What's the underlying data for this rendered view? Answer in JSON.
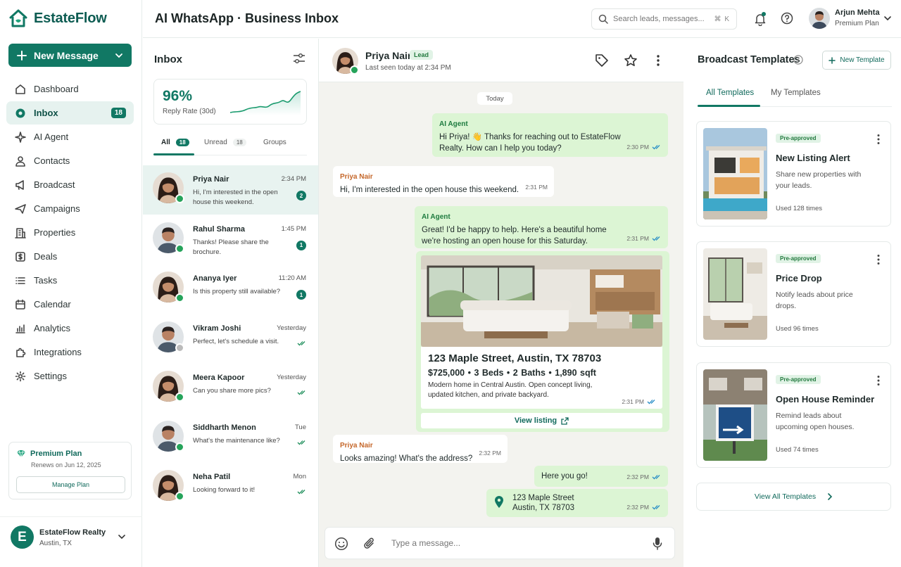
{
  "brand": {
    "name": "EstateFlow",
    "accent": "#117864"
  },
  "sidebar": {
    "new_message": "New Message",
    "items": [
      {
        "label": "Dashboard",
        "icon": "home-icon"
      },
      {
        "label": "Inbox",
        "icon": "inbox-icon",
        "badge": "18",
        "active": true
      },
      {
        "label": "AI Agent",
        "icon": "sparkle-icon"
      },
      {
        "label": "Contacts",
        "icon": "user-icon"
      },
      {
        "label": "Broadcast",
        "icon": "megaphone-icon"
      },
      {
        "label": "Campaigns",
        "icon": "send-icon"
      },
      {
        "label": "Properties",
        "icon": "building-icon"
      },
      {
        "label": "Deals",
        "icon": "dollar-icon"
      },
      {
        "label": "Tasks",
        "icon": "list-icon"
      },
      {
        "label": "Calendar",
        "icon": "calendar-icon"
      },
      {
        "label": "Analytics",
        "icon": "bar-chart-icon"
      },
      {
        "label": "Integrations",
        "icon": "puzzle-icon"
      },
      {
        "label": "Settings",
        "icon": "gear-icon"
      }
    ],
    "plan": {
      "title": "Premium Plan",
      "renews": "Renews on Jun 12, 2025",
      "button": "Manage Plan"
    },
    "account": {
      "initial": "E",
      "name": "EstateFlow Realty",
      "location": "Austin, TX"
    }
  },
  "header": {
    "title": "AI WhatsApp · Business Inbox",
    "search_placeholder": "Search leads, messages...",
    "shortcut": "⌘ K",
    "user": {
      "name": "Arjun Mehta",
      "plan": "Premium Plan"
    }
  },
  "inbox": {
    "title": "Inbox",
    "reply_rate": {
      "value": "96%",
      "label": "Reply Rate (30d)"
    },
    "tabs": [
      {
        "label": "All",
        "count": "18"
      },
      {
        "label": "Unread",
        "count": "18"
      },
      {
        "label": "Groups",
        "count": ""
      }
    ],
    "conversations": [
      {
        "name": "Priya Nair",
        "time": "2:34 PM",
        "preview": "Hi, I'm interested in the open house this weekend.",
        "unread": "2",
        "avatar": "female",
        "selected": true,
        "online": true
      },
      {
        "name": "Rahul Sharma",
        "time": "1:45 PM",
        "preview": "Thanks! Please share the brochure.",
        "unread": "1",
        "avatar": "male",
        "online": true
      },
      {
        "name": "Ananya Iyer",
        "time": "11:20 AM",
        "preview": "Is this property still available?",
        "unread": "1",
        "avatar": "female",
        "online": true
      },
      {
        "name": "Vikram Joshi",
        "time": "Yesterday",
        "preview": "Perfect, let's schedule a visit.",
        "unread": "",
        "avatar": "male",
        "online": false
      },
      {
        "name": "Meera Kapoor",
        "time": "Yesterday",
        "preview": "Can you share more pics?",
        "unread": "",
        "avatar": "female",
        "online": true
      },
      {
        "name": "Siddharth Menon",
        "time": "Tue",
        "preview": "What's the maintenance like?",
        "unread": "",
        "avatar": "male",
        "online": true
      },
      {
        "name": "Neha Patil",
        "time": "Mon",
        "preview": "Looking forward to it!",
        "unread": "",
        "avatar": "female",
        "online": true
      }
    ]
  },
  "chat": {
    "contact": {
      "name": "Priya Nair",
      "tag": "Lead",
      "last_seen": "Last seen today at 2:34 PM"
    },
    "day": "Today",
    "messages": [
      {
        "dir": "out",
        "sender": "AI Agent",
        "text": "Hi Priya! 👋 Thanks for reaching out to EstateFlow Realty. How can I help you today?",
        "time": "2:30 PM"
      },
      {
        "dir": "in",
        "sender": "Priya Nair",
        "text": "Hi, I'm interested in the open house this weekend.",
        "time": "2:31 PM"
      },
      {
        "dir": "out",
        "sender": "AI Agent",
        "text": "Great! I'd be happy to help. Here's a beautiful home we're hosting an open house for this Saturday.",
        "time": "2:31 PM"
      },
      {
        "dir": "in",
        "sender": "Priya Nair",
        "text": "Looks amazing! What's the address?",
        "time": "2:32 PM"
      },
      {
        "dir": "out",
        "sender": "",
        "text": "Here you go!",
        "time": "2:32 PM"
      }
    ],
    "listing": {
      "address": "123 Maple Street, Austin, TX 78703",
      "price_line": "$725,000  •  3 Beds  •  2 Baths  •  1,890 sqft",
      "description": "Modern home in Central Austin. Open concept living, updated kitchen, and private backyard.",
      "time": "2:31 PM",
      "link": "View listing"
    },
    "location": {
      "line1": "123 Maple Street",
      "line2": "Austin, TX 78703",
      "time": "2:32 PM"
    },
    "composer_placeholder": "Type a message..."
  },
  "templates": {
    "title": "Broadcast Templates",
    "new_button": "New Template",
    "tabs": [
      "All Templates",
      "My Templates"
    ],
    "items": [
      {
        "badge": "Pre-approved",
        "name": "New Listing Alert",
        "description": "Share new properties with your leads.",
        "usage": "Used 128 times",
        "image": "modern-house"
      },
      {
        "badge": "Pre-approved",
        "name": "Price Drop",
        "description": "Notify leads about price drops.",
        "usage": "Used 96 times",
        "image": "living-room"
      },
      {
        "badge": "Pre-approved",
        "name": "Open House Reminder",
        "description": "Remind leads about upcoming open houses.",
        "usage": "Used 74 times",
        "image": "open-house-sign"
      }
    ],
    "view_all": "View All Templates"
  }
}
